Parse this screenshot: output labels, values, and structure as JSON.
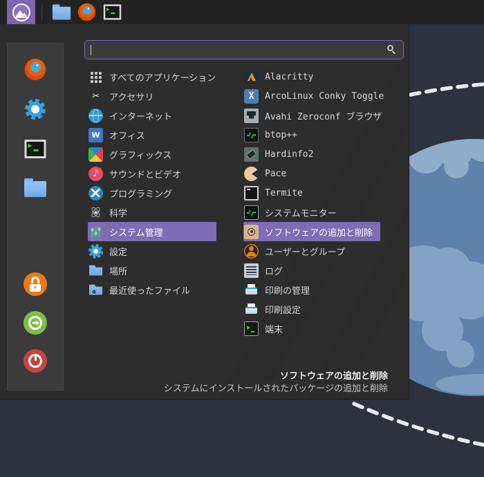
{
  "panel": {
    "launcher_icon": "arcolinux-logo",
    "items": [
      {
        "icon": "file-manager"
      },
      {
        "icon": "firefox"
      },
      {
        "icon": "terminal"
      }
    ]
  },
  "search": {
    "value": "",
    "icon": "magnifier"
  },
  "sidebar": {
    "favorites": [
      {
        "icon": "firefox"
      },
      {
        "icon": "settings"
      },
      {
        "icon": "terminal"
      },
      {
        "icon": "file-manager"
      }
    ],
    "session": [
      {
        "icon": "lock-screen"
      },
      {
        "icon": "logout"
      },
      {
        "icon": "shutdown"
      }
    ]
  },
  "menu": {
    "categories": [
      {
        "label": "すべてのアプリケーション",
        "icon": "apps-grid"
      },
      {
        "label": "アクセサリ",
        "icon": "scissors"
      },
      {
        "label": "インターネット",
        "icon": "globe"
      },
      {
        "label": "オフィス",
        "icon": "office"
      },
      {
        "label": "グラフィックス",
        "icon": "graphics"
      },
      {
        "label": "サウンドとビデオ",
        "icon": "music"
      },
      {
        "label": "プログラミング",
        "icon": "programming"
      },
      {
        "label": "科学",
        "icon": "atom"
      },
      {
        "label": "システム管理",
        "icon": "sliders"
      },
      {
        "label": "設定",
        "icon": "gear"
      },
      {
        "label": "場所",
        "icon": "folder"
      },
      {
        "label": "最近使ったファイル",
        "icon": "folder-clock"
      }
    ],
    "applications": [
      {
        "label": "Alacritty",
        "icon": "alacritty"
      },
      {
        "label": "ArcoLinux Conky Toggle",
        "icon": "conky"
      },
      {
        "label": "Avahi Zeroconf ブラウザ",
        "icon": "avahi"
      },
      {
        "label": "btop++",
        "icon": "btop"
      },
      {
        "label": "Hardinfo2",
        "icon": "hardinfo"
      },
      {
        "label": "Pace",
        "icon": "pace"
      },
      {
        "label": "Termite",
        "icon": "termite"
      },
      {
        "label": "システムモニター",
        "icon": "sysmon"
      },
      {
        "label": "ソフトウェアの追加と削除",
        "icon": "pamac"
      },
      {
        "label": "ユーザーとグループ",
        "icon": "users"
      },
      {
        "label": "ログ",
        "icon": "log"
      },
      {
        "label": "印刷の管理",
        "icon": "printer"
      },
      {
        "label": "印刷設定",
        "icon": "printer"
      },
      {
        "label": "端末",
        "icon": "terminal-sm"
      }
    ],
    "selection": {
      "category": "システム管理",
      "application": "ソフトウェアの追加と削除"
    },
    "footer": {
      "title": "ソフトウェアの追加と削除",
      "description": "システムにインストールされたパッケージの追加と削除"
    }
  },
  "colors": {
    "accent": "#7E6CB4",
    "panel_bg": "#232323",
    "menu_bg": "#2D2D2D",
    "sidebar_bg": "#3B3B3B",
    "wallpaper": "#2C3240",
    "planet": "#5E82AC",
    "continent": "#84A2C3",
    "text": "#D6D6D6"
  }
}
